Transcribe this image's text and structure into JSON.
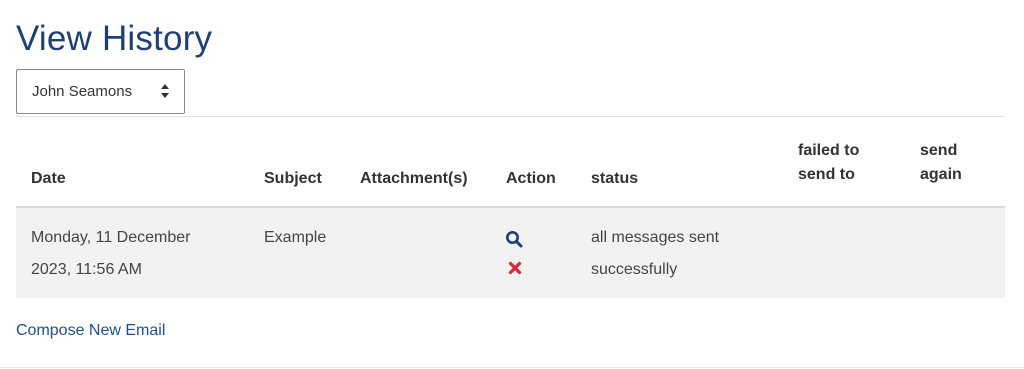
{
  "page": {
    "title": "View History"
  },
  "user_select": {
    "selected": "John Seamons"
  },
  "table": {
    "headers": {
      "date": "Date",
      "subject": "Subject",
      "attachments": "Attachment(s)",
      "action": "Action",
      "status": "status",
      "failed_to_send_to": [
        "failed to",
        "send to"
      ],
      "send_again": [
        "send",
        "again"
      ]
    },
    "rows": [
      {
        "date": "Monday, 11 December 2023, 11:56 AM",
        "subject": "Example",
        "attachments": "",
        "status": "all messages sent successfully",
        "failed_to_send_to": "",
        "send_again": "",
        "actions": [
          "search-icon",
          "delete-icon"
        ]
      }
    ]
  },
  "footer": {
    "compose_link": "Compose New Email"
  },
  "colors": {
    "title": "#1d3f7a",
    "link": "#1d4f91",
    "view_icon": "#1d3f7a",
    "delete_icon": "#d9283a",
    "row_background": "#f2f2f2"
  }
}
